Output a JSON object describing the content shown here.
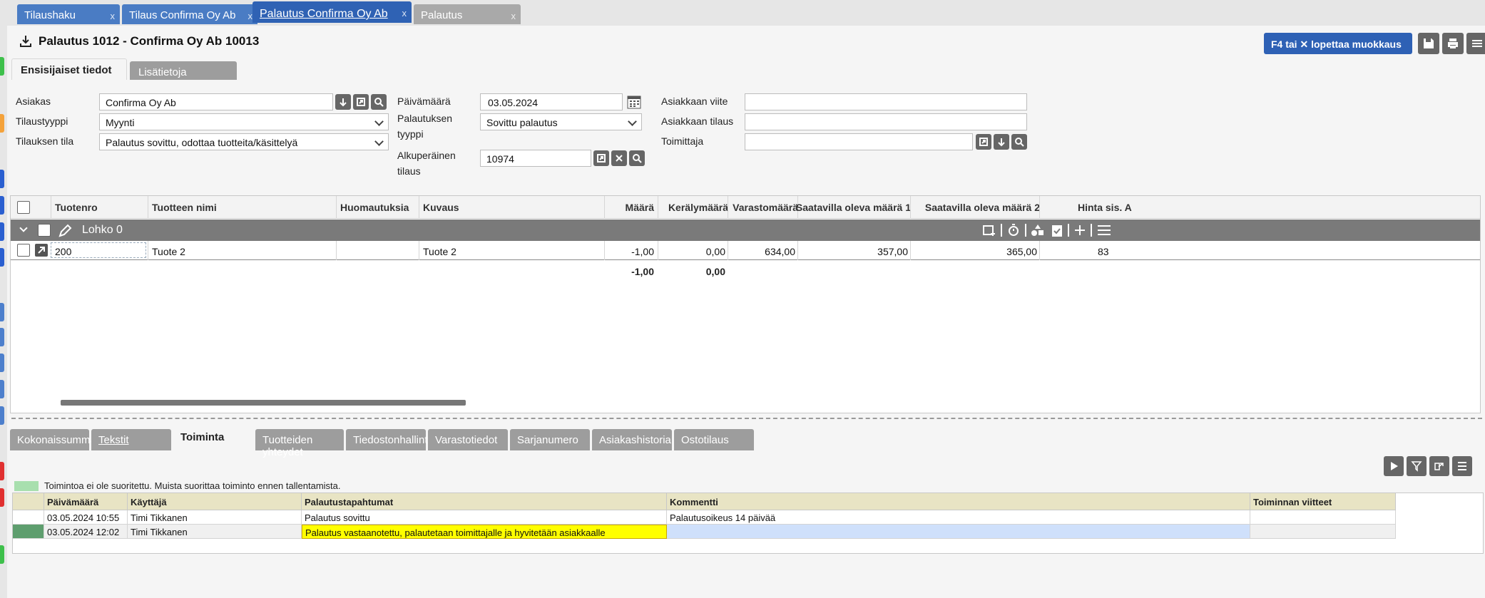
{
  "top_tabs": [
    {
      "label": "Tilaushaku",
      "close": "x"
    },
    {
      "label": "Tilaus Confirma Oy Ab",
      "close": "x"
    },
    {
      "label": "Palautus Confirma Oy Ab",
      "close": "x"
    },
    {
      "label": "Palautus",
      "close": "x"
    }
  ],
  "header": {
    "title": "Palautus 1012 - Confirma Oy Ab 10013",
    "f4_label": "F4 tai ✕ lopettaa muokkaus"
  },
  "sub_tabs": [
    "Ensisijaiset tiedot",
    "Lisätietoja"
  ],
  "form": {
    "asiakas_label": "Asiakas",
    "asiakas_value": "Confirma Oy Ab",
    "tilaustyyppi_label": "Tilaustyyppi",
    "tilaustyyppi_value": "Myynti",
    "tilauksen_tila_label": "Tilauksen tila",
    "tilauksen_tila_value": "Palautus sovittu, odottaa tuotteita/käsittelyä",
    "paivamaara_label": "Päivämäärä",
    "paivamaara_value": "03.05.2024",
    "palautuksen_label_1": "Palautuksen",
    "palautuksen_label_2": "tyyppi",
    "palautuksen_value": "Sovittu palautus",
    "alkuperainen_label_1": "Alkuperäinen",
    "alkuperainen_label_2": "tilaus",
    "alkuperainen_value": "10974",
    "asiakkaan_viite_label": "Asiakkaan viite",
    "asiakkaan_viite_value": "",
    "asiakkaan_tilaus_label": "Asiakkaan tilaus",
    "asiakkaan_tilaus_value": "",
    "toimittaja_label": "Toimittaja",
    "toimittaja_value": ""
  },
  "grid": {
    "headers": [
      "Tuotenro",
      "Tuotteen nimi",
      "Huomautuksia",
      "Kuvaus",
      "Määrä",
      "Kerälymäärä",
      "Varastomäärä",
      "Saatavilla oleva määrä 1",
      "Saatavilla oleva määrä 2",
      "Hinta sis. A"
    ],
    "group_label": "Lohko 0",
    "row": {
      "tuotenro": "200",
      "nimi": "Tuote 2",
      "huomautuksia": "",
      "kuvaus": "Tuote 2",
      "maara": "-1,00",
      "keraily": "0,00",
      "varasto": "634,00",
      "saatavilla1": "357,00",
      "saatavilla2": "365,00",
      "hinta": "83"
    },
    "totals": {
      "maara": "-1,00",
      "keraily": "0,00"
    }
  },
  "bottom_tabs": [
    "Kokonaissummat",
    "Tekstit",
    "Toiminta",
    "Tuotteiden yhteydet",
    "Tiedostonhallinta",
    "Varastotiedot",
    "Sarjanumero",
    "Asiakashistoria",
    "Ostotilaus"
  ],
  "activity": {
    "legend": "Toimintoa ei ole suoritettu. Muista suorittaa toiminto ennen tallentamista.",
    "headers": [
      "Päivämäärä",
      "Käyttäjä",
      "Palautustapahtumat",
      "Kommentti",
      "Toiminnan viitteet"
    ],
    "rows": [
      {
        "date": "03.05.2024 10:55",
        "user": "Timi Tikkanen",
        "event": "Palautus sovittu",
        "comment": "Palautusoikeus 14 päivää",
        "refs": ""
      },
      {
        "date": "03.05.2024 12:02",
        "user": "Timi Tikkanen",
        "event": "Palautus vastaanotettu, palautetaan toimittajalle ja hyvitetään asiakkaalle",
        "comment": "",
        "refs": ""
      }
    ]
  },
  "colors": {
    "accent": "#2f62b4",
    "tab_gray": "#a9a9a9",
    "group_bar": "#7a7a7a",
    "highlight_yellow": "#ffff00",
    "pending_green": "#5e9e6e",
    "comment_blue": "#cfe0fb"
  }
}
